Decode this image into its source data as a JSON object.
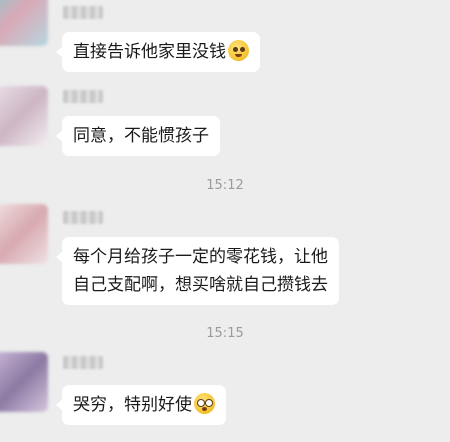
{
  "messages": [
    {
      "text": "直接告诉他家里没钱",
      "emoji": "thinking-face-icon"
    },
    {
      "text": "同意，不能惯孩子"
    },
    {
      "line1": "每个月给孩子一定的零花钱，让他",
      "line2": "自己支配啊，想买啥就自己攒钱去"
    },
    {
      "text": "哭穷，特别好使",
      "emoji": "flushed-face-icon"
    }
  ],
  "timestamps": [
    "15:12",
    "15:15"
  ],
  "colors": {
    "background": "#ededed",
    "bubble": "#ffffff",
    "text": "#1a1a1a",
    "timestamp": "#9b9b9b"
  }
}
